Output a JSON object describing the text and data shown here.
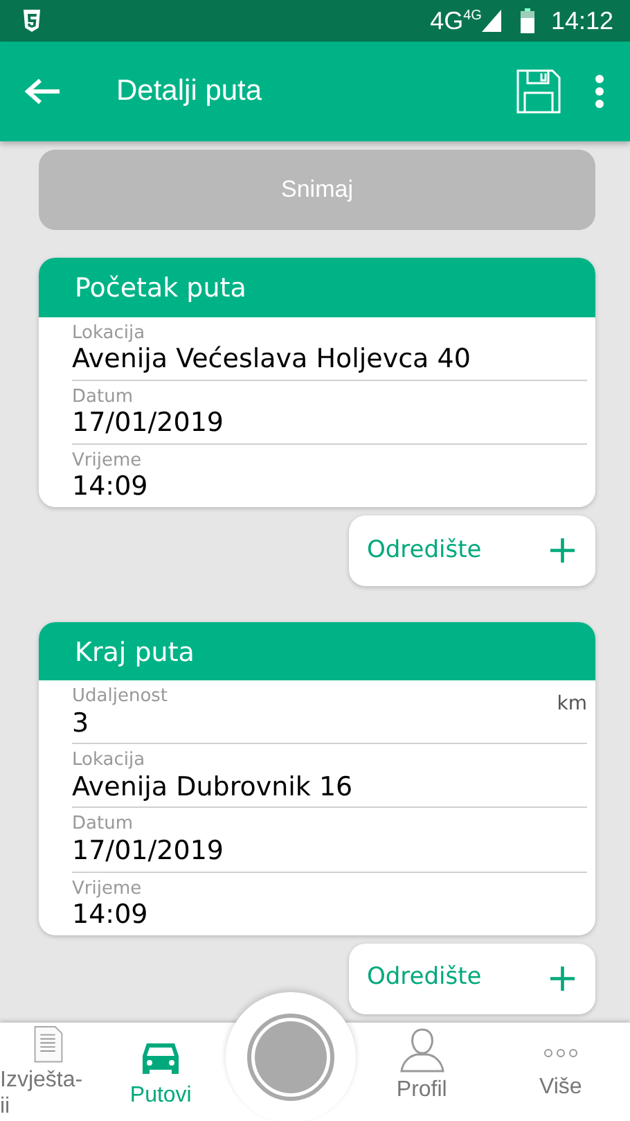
{
  "status_bar": {
    "network": "4G",
    "network_small": "4G",
    "time": "14:12"
  },
  "app_bar": {
    "title": "Detalji puta"
  },
  "save_button": {
    "label": "Snimaj",
    "disabled": true
  },
  "sections": [
    {
      "title": "Početak puta",
      "fields": [
        {
          "label": "Lokacija",
          "value": "Avenija Većeslava Holjevca 40"
        },
        {
          "label": "Datum",
          "value": "17/01/2019"
        },
        {
          "label": "Vrijeme",
          "value": "14:09"
        }
      ],
      "action": {
        "label": "Odredište",
        "icon": "+"
      }
    },
    {
      "title": "Kraj puta",
      "fields": [
        {
          "label": "Udaljenost",
          "value": "3",
          "unit": "km"
        },
        {
          "label": "Lokacija",
          "value": "Avenija Dubrovnik 16"
        },
        {
          "label": "Datum",
          "value": "17/01/2019"
        },
        {
          "label": "Vrijeme",
          "value": "14:09"
        }
      ],
      "action": {
        "label": "Odredište",
        "icon": "+"
      }
    }
  ],
  "bottom_nav": [
    {
      "label": "Izvješta-ii",
      "kind": "report",
      "selected": false
    },
    {
      "label": "Putovi",
      "kind": "car",
      "selected": true
    },
    {
      "kind": "record"
    },
    {
      "label": "Profil",
      "kind": "person",
      "selected": false
    },
    {
      "label": "Više",
      "kind": "more",
      "selected": false
    }
  ]
}
